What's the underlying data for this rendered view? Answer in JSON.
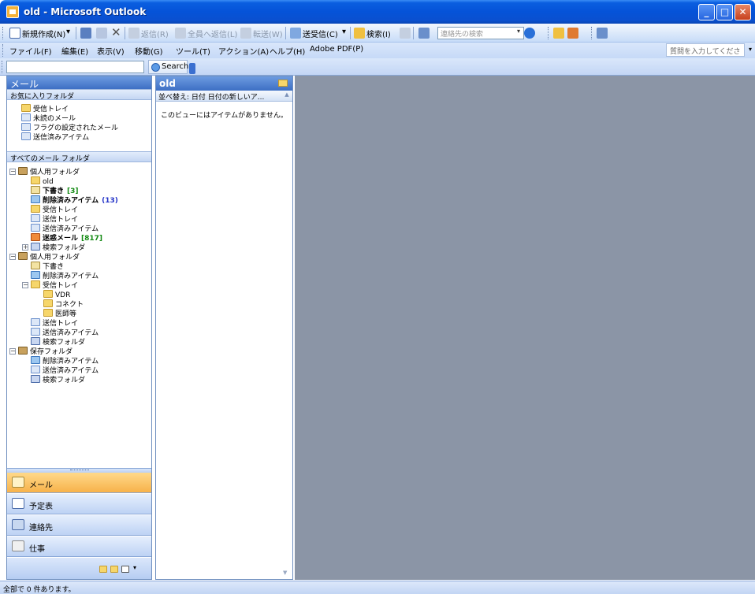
{
  "window": {
    "title": "old - Microsoft Outlook"
  },
  "toolbar": {
    "new_label": "新規作成(N)",
    "reply_label": "返信(R)",
    "reply_all_label": "全員へ返信(L)",
    "forward_label": "転送(W)",
    "send_receive_label": "送受信(C)",
    "find_label": "検索(I)",
    "contacts_search_placeholder": "連絡先の検索",
    "search_button_label": "Search"
  },
  "menu": {
    "items": [
      "ファイル(F)",
      "編集(E)",
      "表示(V)",
      "移動(G)",
      "ツール(T)",
      "アクション(A)",
      "ヘルプ(H)",
      "Adobe PDF(P)"
    ],
    "help_placeholder": "質問を入力してください"
  },
  "nav": {
    "header": "メール",
    "favorites_header": "お気に入りフォルダ",
    "favorites": [
      {
        "label": "受信トレイ",
        "icon": "inbox-icon"
      },
      {
        "label": "未読のメール",
        "icon": "unread-mail-icon"
      },
      {
        "label": "フラグの設定されたメール",
        "icon": "flagged-mail-icon"
      },
      {
        "label": "送信済みアイテム",
        "icon": "sent-items-icon"
      }
    ],
    "all_folders_header": "すべてのメール フォルダ",
    "tree": [
      {
        "label": "個人用フォルダ"
      },
      {
        "label": "old"
      },
      {
        "label": "下書き",
        "count": "[3]"
      },
      {
        "label": "削除済みアイテム",
        "count": "(13)"
      },
      {
        "label": "受信トレイ"
      },
      {
        "label": "送信トレイ"
      },
      {
        "label": "送信済みアイテム"
      },
      {
        "label": "迷惑メール",
        "count": "[817]"
      },
      {
        "label": "検索フォルダ"
      },
      {
        "label": "個人用フォルダ"
      },
      {
        "label": "下書き"
      },
      {
        "label": "削除済みアイテム"
      },
      {
        "label": "受信トレイ"
      },
      {
        "label": "VDR"
      },
      {
        "label": "コネクト"
      },
      {
        "label": "医師等"
      },
      {
        "label": "送信トレイ"
      },
      {
        "label": "送信済みアイテム"
      },
      {
        "label": "検索フォルダ"
      },
      {
        "label": "保存フォルダ"
      },
      {
        "label": "削除済みアイテム"
      },
      {
        "label": "送信済みアイテム"
      },
      {
        "label": "検索フォルダ"
      }
    ],
    "buttons": [
      {
        "label": "メール"
      },
      {
        "label": "予定表"
      },
      {
        "label": "連絡先"
      },
      {
        "label": "仕事"
      }
    ]
  },
  "message_list": {
    "folder_name": "old",
    "arrange_by": "並べ替え: 日付",
    "sort_order": "日付の新しいア...",
    "empty_text": "このビューにはアイテムがありません。"
  },
  "status": {
    "text": "全部で 0 件あります。"
  },
  "colors": {
    "title_bar": "#0553d8",
    "reading_pane": "#8b95a6",
    "nav_active": "#f7b24a"
  }
}
